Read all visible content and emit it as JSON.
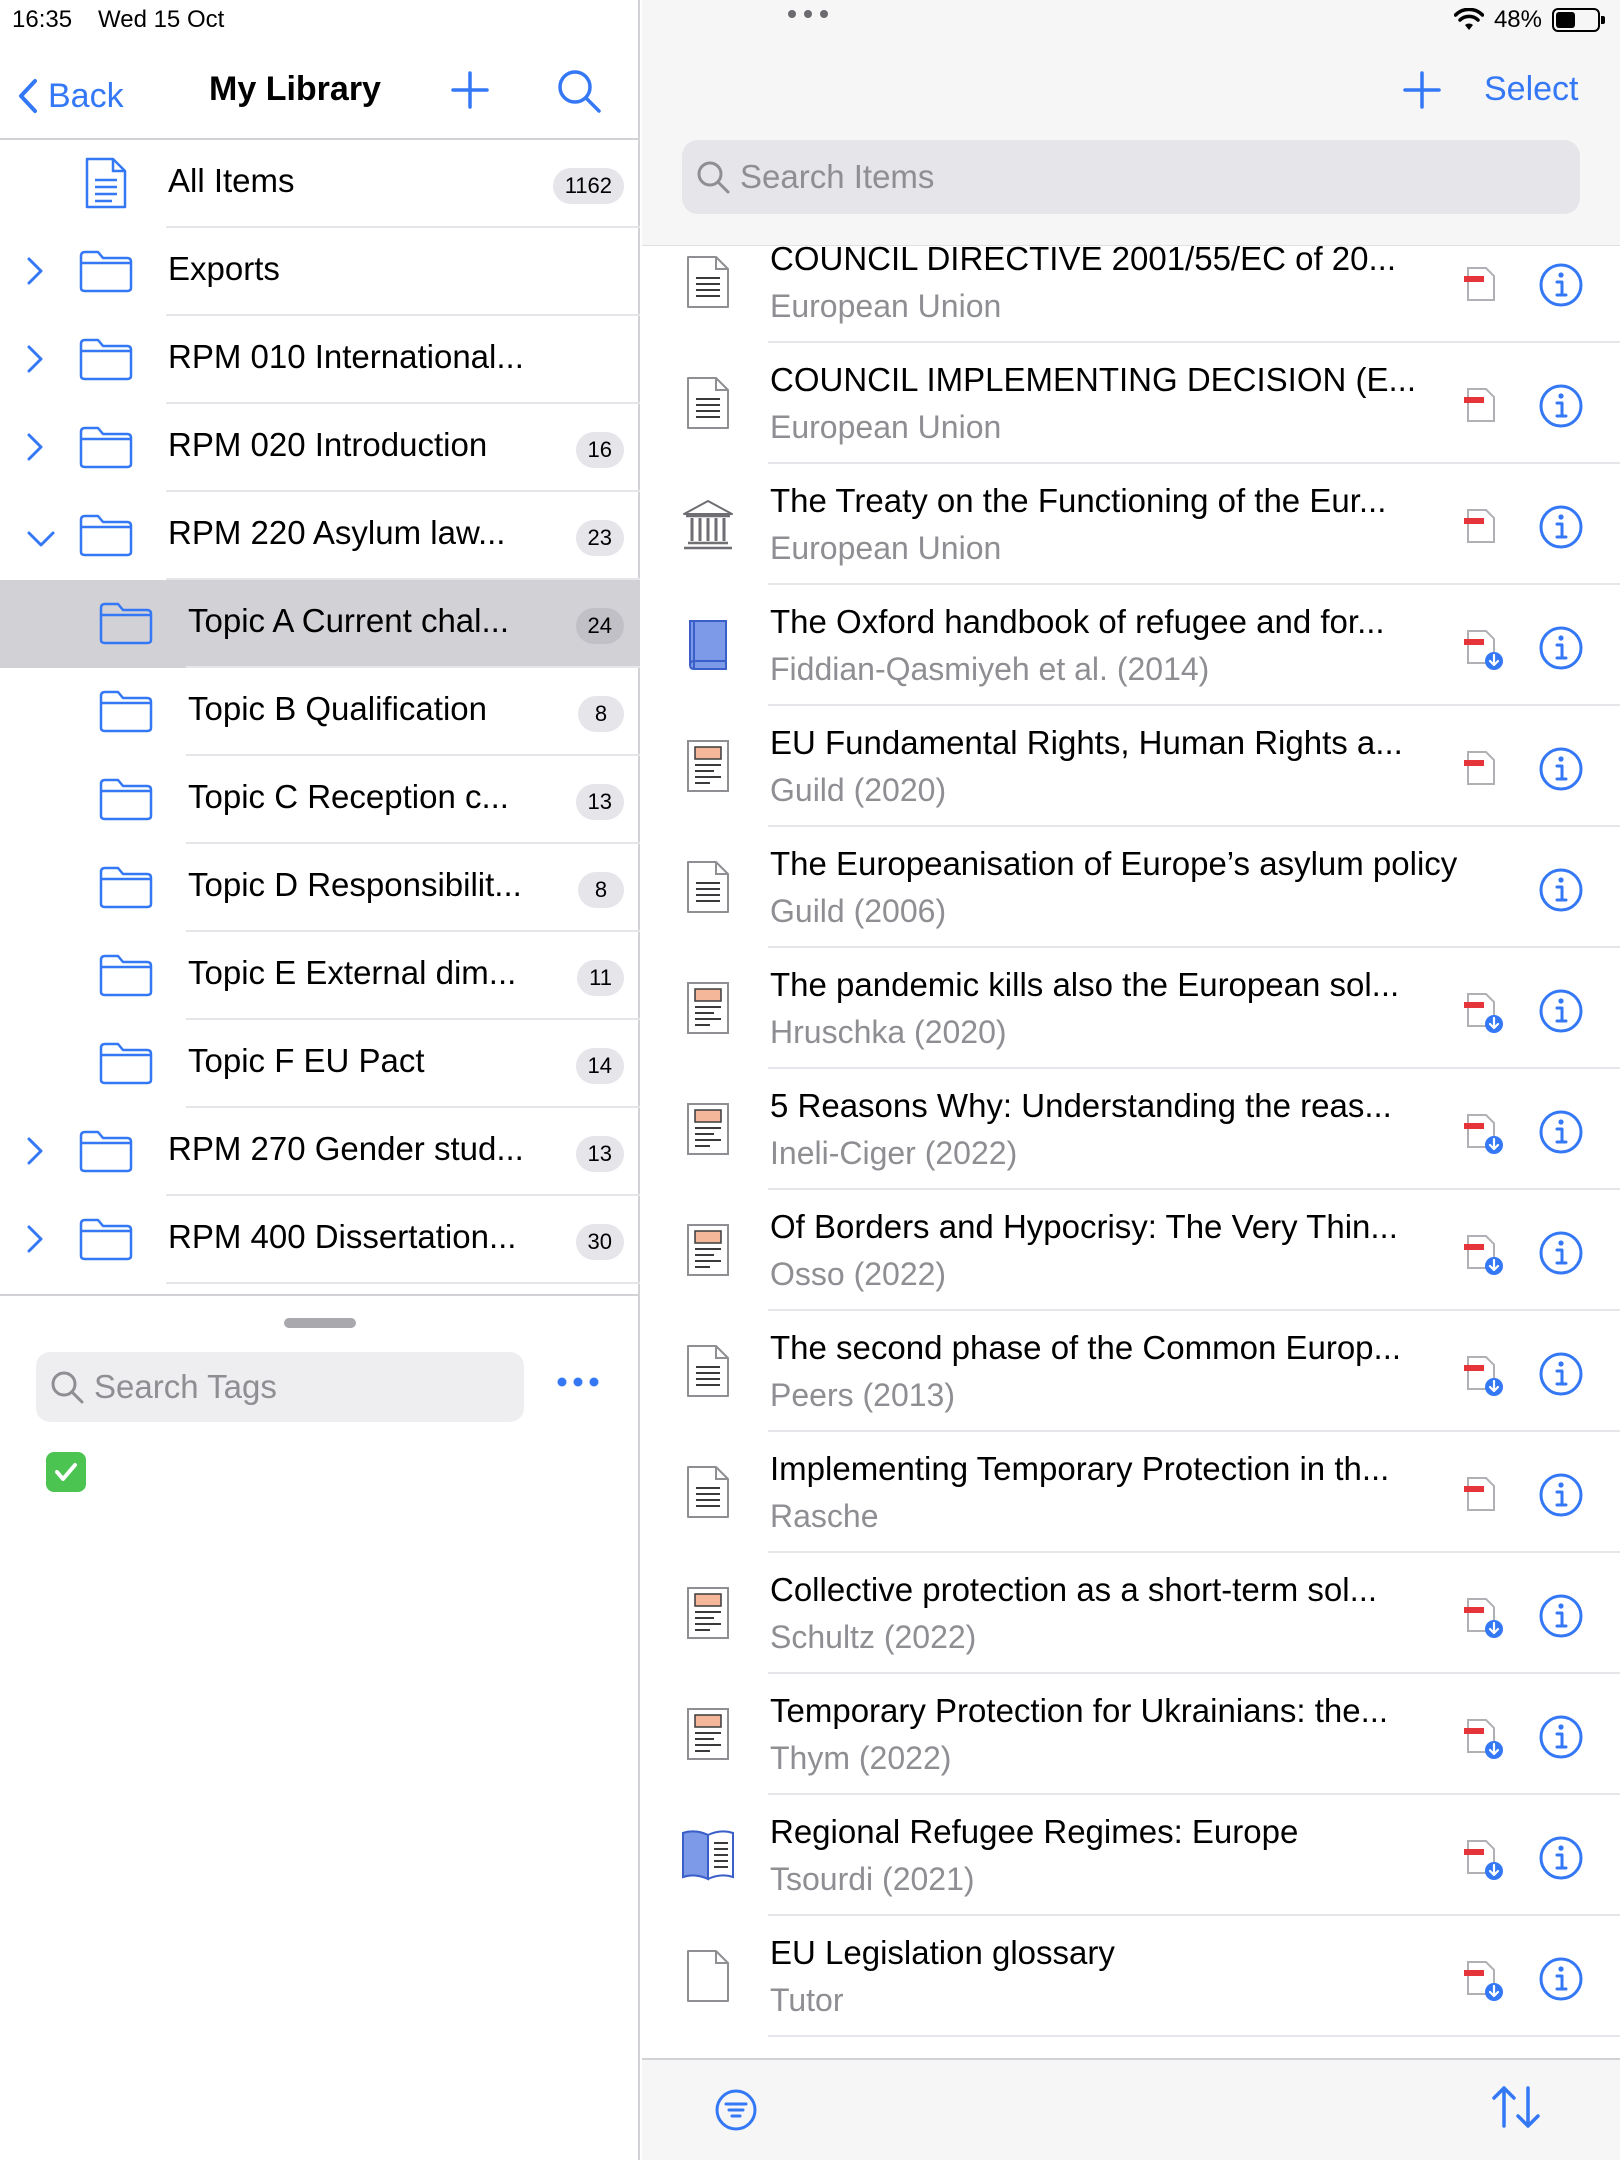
{
  "status_bar": {
    "time": "16:35",
    "date": "Wed 15 Oct",
    "battery": "48%"
  },
  "colors": {
    "accent": "#3478f6",
    "selected_row": "#d1d1d6",
    "secondary_text": "#8e8e93",
    "attachment_red": "#e5343a"
  },
  "sidebar": {
    "back_label": "Back",
    "title": "My Library",
    "collections": [
      {
        "label": "All Items",
        "count": "1162",
        "icon": "document-icon"
      },
      {
        "label": "Exports",
        "count": "",
        "icon": "folder-icon",
        "chevron": "right"
      },
      {
        "label": "RPM 010 International...",
        "count": "",
        "icon": "folder-icon",
        "chevron": "right"
      },
      {
        "label": "RPM 020 Introduction",
        "count": "16",
        "icon": "folder-icon",
        "chevron": "right"
      },
      {
        "label": "RPM 220 Asylum law...",
        "count": "23",
        "icon": "folder-icon",
        "chevron": "down"
      },
      {
        "label": "Topic A Current chal...",
        "count": "24",
        "icon": "folder-icon",
        "selected": true
      },
      {
        "label": "Topic B Qualification",
        "count": "8",
        "icon": "folder-icon"
      },
      {
        "label": "Topic C Reception c...",
        "count": "13",
        "icon": "folder-icon"
      },
      {
        "label": "Topic D Responsibilit...",
        "count": "8",
        "icon": "folder-icon"
      },
      {
        "label": "Topic E External dim...",
        "count": "11",
        "icon": "folder-icon"
      },
      {
        "label": "Topic F EU Pact",
        "count": "14",
        "icon": "folder-icon"
      },
      {
        "label": "RPM 270 Gender stud...",
        "count": "13",
        "icon": "folder-icon",
        "chevron": "right"
      },
      {
        "label": "RPM 400 Dissertation...",
        "count": "30",
        "icon": "folder-icon",
        "chevron": "right"
      }
    ],
    "tag_search_placeholder": "Search Tags"
  },
  "main": {
    "select_label": "Select",
    "search_placeholder": "Search Items",
    "items": [
      {
        "title": "COUNCIL DIRECTIVE 2001/55/EC  of 20...",
        "subtitle": "European Union",
        "type": "document-icon",
        "attachment": "pdf-icon"
      },
      {
        "title": "COUNCIL IMPLEMENTING DECISION (E...",
        "subtitle": "European Union",
        "type": "document-icon",
        "attachment": "pdf-icon"
      },
      {
        "title": "The Treaty on the Functioning of the Eur...",
        "subtitle": "European Union",
        "type": "statute-icon",
        "attachment": "pdf-icon"
      },
      {
        "title": "The Oxford handbook of refugee and for...",
        "subtitle": "Fiddian-Qasmiyeh et al. (2014)",
        "type": "book-icon",
        "attachment": "pdf-download-icon"
      },
      {
        "title": "EU Fundamental Rights, Human Rights a...",
        "subtitle": "Guild (2020)",
        "type": "journal-article-icon",
        "attachment": "pdf-icon"
      },
      {
        "title": "The Europeanisation of Europe’s asylum policy",
        "subtitle": "Guild (2006)",
        "type": "document-icon",
        "attachment": ""
      },
      {
        "title": "The pandemic kills also the European sol...",
        "subtitle": "Hruschka (2020)",
        "type": "journal-article-icon",
        "attachment": "pdf-download-icon"
      },
      {
        "title": "5 Reasons Why: Understanding the reas...",
        "subtitle": "Ineli-Ciger (2022)",
        "type": "journal-article-icon",
        "attachment": "pdf-download-icon"
      },
      {
        "title": "Of Borders and Hypocrisy: The Very Thin...",
        "subtitle": "Osso (2022)",
        "type": "journal-article-icon",
        "attachment": "pdf-download-icon"
      },
      {
        "title": "The second phase of the Common Europ...",
        "subtitle": "Peers (2013)",
        "type": "document-icon",
        "attachment": "pdf-download-icon"
      },
      {
        "title": "Implementing Temporary Protection in th...",
        "subtitle": "Rasche",
        "type": "document-icon",
        "attachment": "pdf-icon"
      },
      {
        "title": "Collective protection as a short-term sol...",
        "subtitle": "Schultz (2022)",
        "type": "journal-article-icon",
        "attachment": "pdf-download-icon"
      },
      {
        "title": "Temporary Protection for Ukrainians: the...",
        "subtitle": "Thym (2022)",
        "type": "journal-article-icon",
        "attachment": "pdf-download-icon"
      },
      {
        "title": "Regional Refugee Regimes: Europe",
        "subtitle": "Tsourdi (2021)",
        "type": "book-section-icon",
        "attachment": "pdf-download-icon"
      },
      {
        "title": "EU Legislation glossary",
        "subtitle": "Tutor",
        "type": "blank-document-icon",
        "attachment": "pdf-download-icon"
      }
    ]
  }
}
